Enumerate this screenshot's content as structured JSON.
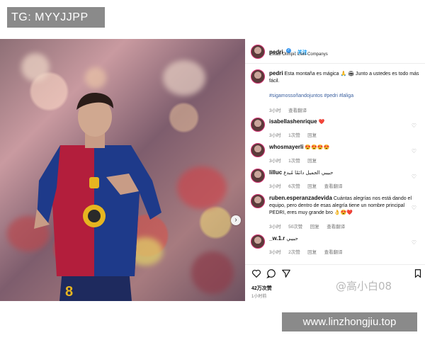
{
  "tg_banner": "TG: MYYJJPP",
  "url_banner": "www.linzhongjiu.top",
  "watermark": "@高小白08",
  "jersey_number": "8",
  "post": {
    "username": "pedri",
    "follow_label": "· 关注",
    "location": "Estadi Olimpic Lluis Companys",
    "caption_user": "pedri",
    "caption_text": "Esta montaña es mágica 🙏 🏟 Junto a ustedes es todo más fácil.",
    "hashtags": "#sigamossoñandojuntos #pedri #laliga",
    "caption_time": "3小时",
    "caption_translate": "查看翻译",
    "likes": "42万次赞",
    "posted_ago": "1小时前"
  },
  "comments": [
    {
      "user": "isabellashenrique",
      "text": "❤️",
      "time": "3小时",
      "likes": "1次赞",
      "reply": "回复",
      "translate": ""
    },
    {
      "user": "whosmayerli",
      "text": "😍😍😍😍",
      "time": "3小时",
      "likes": "1次赞",
      "reply": "回复",
      "translate": ""
    },
    {
      "user": "lilluc",
      "text": "حبيبي الجميل دائمًا مُبدع",
      "time": "3小时",
      "likes": "6次赞",
      "reply": "回复",
      "translate": "查看翻译"
    },
    {
      "user": "ruben.esperanzadevida",
      "text": "Cuántas alegrías nos está dando el equipo, pero dentro de esas alegría tiene un nombre principal PEDRI, eres muy grande bro 👌😍❤️",
      "time": "3小时",
      "likes": "50次赞",
      "reply": "回复",
      "translate": "查看翻译"
    },
    {
      "user": "_w.1.r",
      "text": "حبيبي",
      "time": "3小时",
      "likes": "2次赞",
      "reply": "回复",
      "translate": "查看翻译"
    }
  ],
  "colors": {
    "verified": "#3897f0",
    "follow": "#0095f6",
    "heart": "#ed4956",
    "banner": "#8a8a8a"
  },
  "icons": [
    "heart-icon",
    "comment-icon",
    "share-icon",
    "bookmark-icon",
    "next-arrow-icon",
    "verified-icon"
  ]
}
